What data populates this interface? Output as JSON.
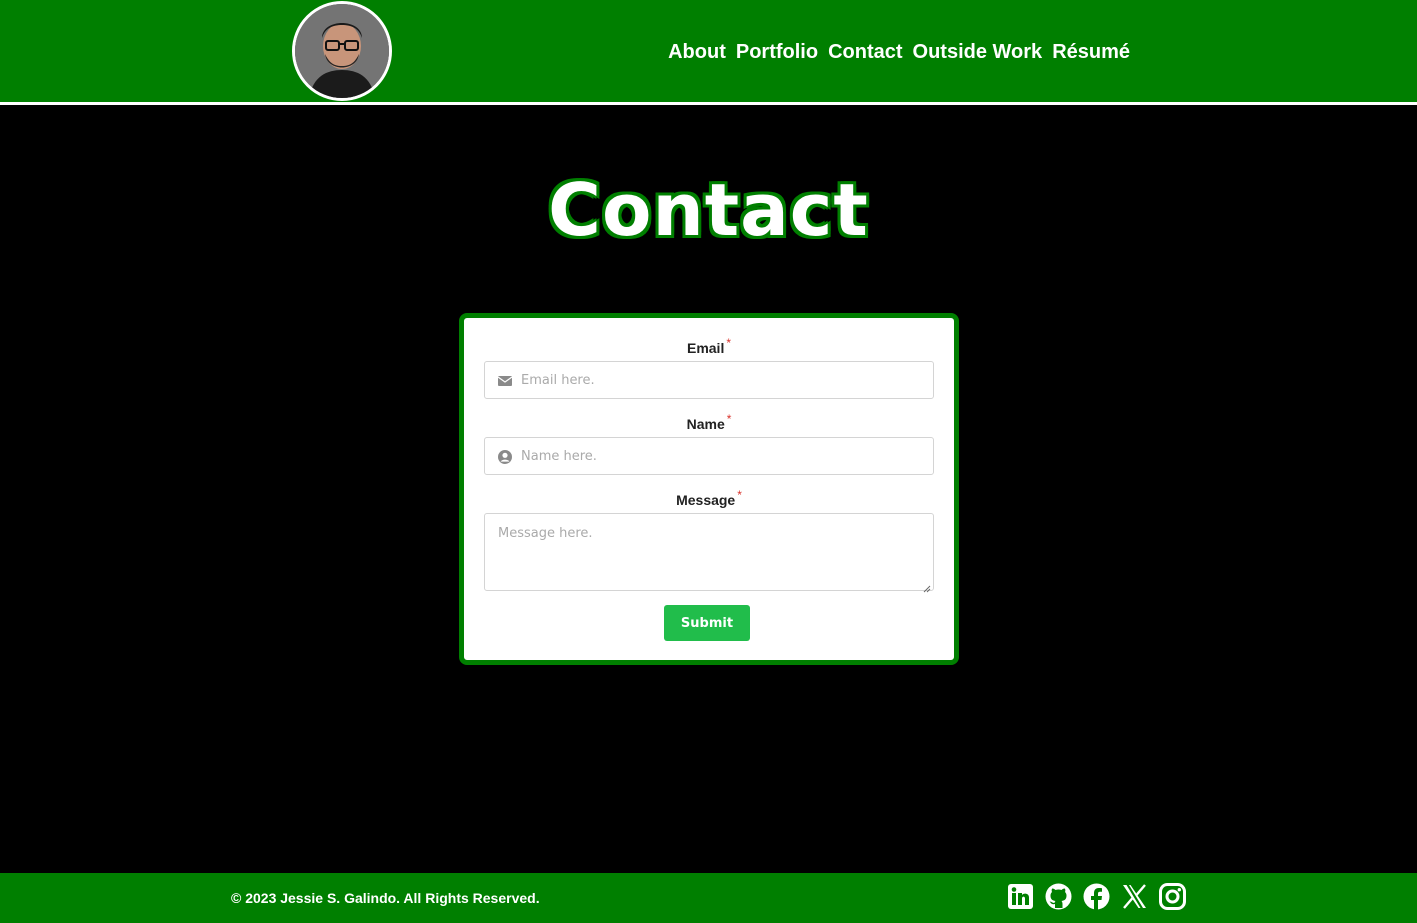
{
  "header": {
    "avatar_alt": "Profile photo",
    "nav": [
      "About",
      "Portfolio",
      "Contact",
      "Outside Work",
      "Résumé"
    ]
  },
  "main": {
    "title": "Contact"
  },
  "form": {
    "email": {
      "label": "Email",
      "required_mark": "*",
      "placeholder": "Email here."
    },
    "name": {
      "label": "Name",
      "required_mark": "*",
      "placeholder": "Name here."
    },
    "message": {
      "label": "Message",
      "required_mark": "*",
      "placeholder": "Message here."
    },
    "submit_label": "Submit"
  },
  "footer": {
    "copyright": "© 2023 Jessie S. Galindo. All Rights Reserved.",
    "social_icons": [
      "linkedin-icon",
      "github-icon",
      "facebook-icon",
      "x-icon",
      "instagram-icon"
    ]
  },
  "colors": {
    "brand_green": "#007f00",
    "button_green": "#21bd4b",
    "background": "#000000",
    "required_red": "#d9322b"
  }
}
